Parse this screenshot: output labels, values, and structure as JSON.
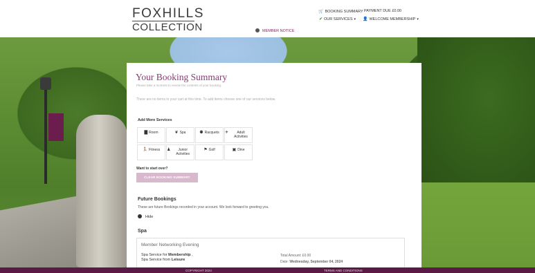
{
  "brand": {
    "line1": "FOXHILLS",
    "line2": "COLLECTION"
  },
  "topnav": {
    "booking_summary": "BOOKING SUMMARY",
    "payment_due": "PAYMENT DUE £0.00",
    "our_services": "OUR SERVICES",
    "welcome": "WELCOME MEMBERSHIP",
    "cart_icon": "cart-icon",
    "check_icon": "check-icon",
    "user_icon": "user-icon"
  },
  "member_notice": "MEMBER NOTICE",
  "panel": {
    "title": "Your Booking Summary",
    "subtitle": "Please take a moment to review the contents of your booking.",
    "empty_message": "There are no items in your cart at this time. To add items choose one of our services below.",
    "add_more_title": "Add More Services",
    "services": [
      {
        "label": "Room",
        "icon": "bed-icon"
      },
      {
        "label": "Spa",
        "icon": "leaf-icon"
      },
      {
        "label": "Racquets",
        "icon": "racquet-icon"
      },
      {
        "label": "Adult Activities",
        "icon": "activities-icon"
      },
      {
        "label": "Fitness",
        "icon": "fitness-icon"
      },
      {
        "label": "Junior Activities",
        "icon": "junior-icon"
      },
      {
        "label": "Golf",
        "icon": "flag-icon"
      },
      {
        "label": "Dine",
        "icon": "dine-icon"
      }
    ],
    "restart_label": "Want to start over?",
    "clear_button": "CLEAR BOOKING SUMMARY",
    "future_title": "Future Bookings",
    "future_desc": "These are future Bookings recorded in your account. We look forward to greeting you.",
    "hide_label": "Hide",
    "spa_heading": "Spa",
    "booking": {
      "title": "Member Networking Evening",
      "line1_prefix": "Spa Service for ",
      "line1_bold": "Membership",
      "line1_suffix": " ,",
      "line2_prefix": "Spa Service from ",
      "line2_bold": "Leisure",
      "total": "Total Amount: £0.00",
      "date_prefix": "Date: ",
      "date_bold": "Wednesday, September 04, 2024"
    }
  },
  "footer": {
    "copyright": "COPYRIGHT 2024",
    "terms": "TERMS AND CONDITIONS"
  },
  "colors": {
    "accent": "#8b3a74",
    "footer_bg": "#5b1a45",
    "button_bg": "#d7b8cc"
  }
}
